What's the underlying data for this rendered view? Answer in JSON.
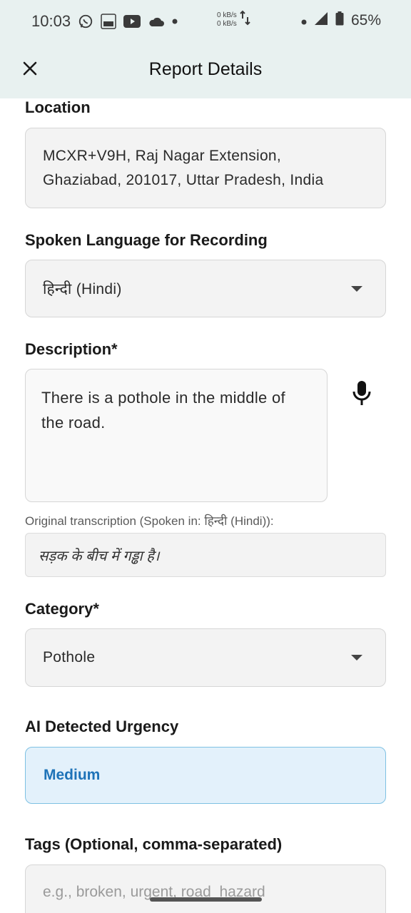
{
  "status_bar": {
    "time": "10:03",
    "net_up": "0 kB/s",
    "net_down": "0 kB/s",
    "battery": "65%"
  },
  "app_bar": {
    "title": "Report Details"
  },
  "form": {
    "location": {
      "label": "Location",
      "value_line1": "MCXR+V9H, Raj Nagar Extension,",
      "value_line2": "Ghaziabad, 201017, Uttar Pradesh, India"
    },
    "spoken_language": {
      "label": "Spoken Language for Recording",
      "selected": "हिन्दी (Hindi)"
    },
    "description": {
      "label": "Description*",
      "value": "There is a pothole in the middle of the road."
    },
    "original_transcription": {
      "label": "Original transcription (Spoken in: हिन्दी (Hindi)):",
      "value": "सड़क के बीच में गड्ढा है।"
    },
    "category": {
      "label": "Category*",
      "selected": "Pothole"
    },
    "urgency": {
      "label": "AI Detected Urgency",
      "value": "Medium"
    },
    "tags": {
      "label": "Tags (Optional, comma-separated)",
      "placeholder": "e.g., broken, urgent, road_hazard"
    }
  },
  "colors": {
    "header_bg": "#e8f1f0",
    "urgency_bg": "#e3f1fb",
    "urgency_border": "#7ec1e3",
    "urgency_text": "#1e73b8"
  },
  "icons": {
    "close": "close-icon",
    "mic": "microphone-icon",
    "dropdown": "dropdown-arrow-icon"
  }
}
